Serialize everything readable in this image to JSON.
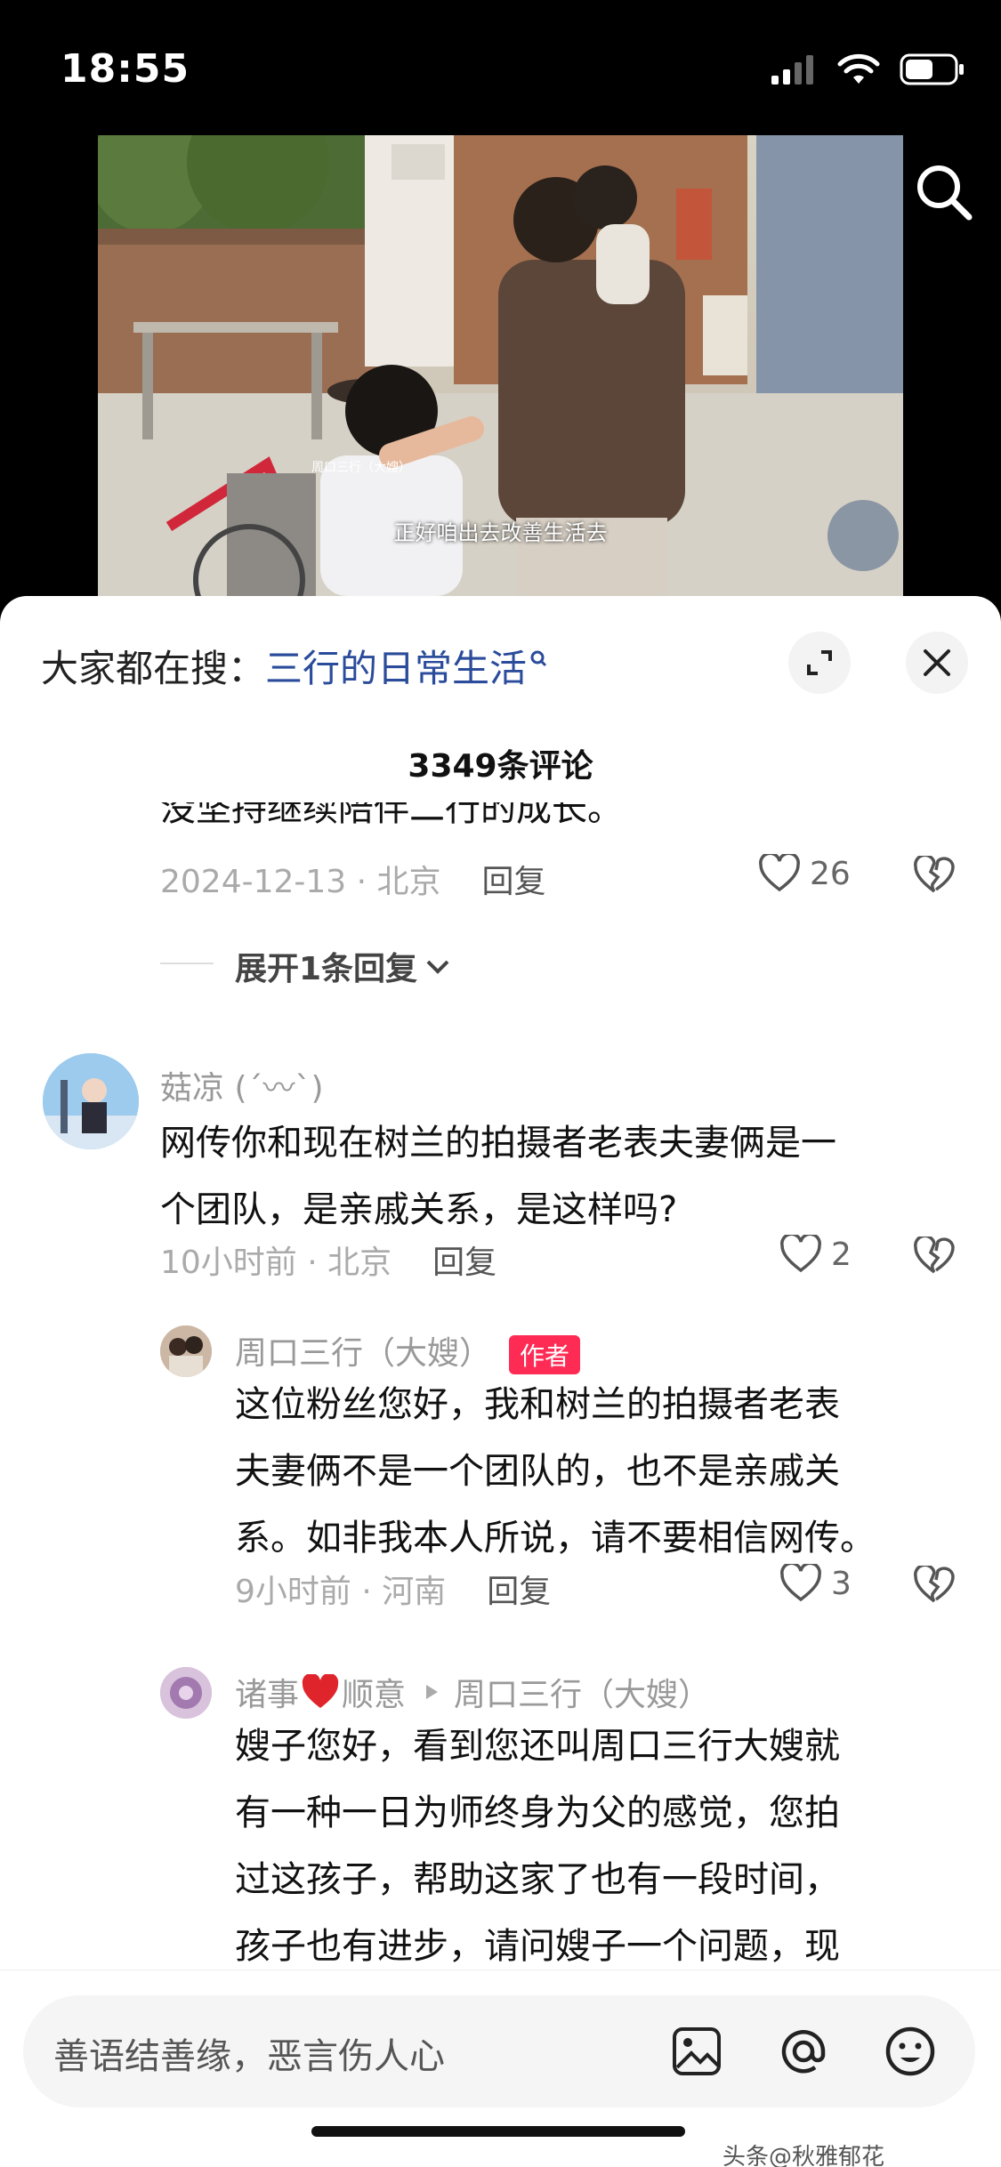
{
  "status_bar": {
    "time": "18:55"
  },
  "video": {
    "caption": "正好咱出去改善生活去"
  },
  "sheet": {
    "hot_search_prefix": "大家都在搜：",
    "hot_search_term": "三行的日常生活",
    "comment_count": "3349条评论"
  },
  "comments": [
    {
      "text_line": "没坚持继续陪伴二行的成长。",
      "time_location": "2024-12-13 · 北京",
      "reply_label": "回复",
      "likes": "26",
      "expand_replies": "展开1条回复"
    },
    {
      "username": "菇凉 (ˊ〰ˋ)",
      "text_lines": [
        "网传你和现在树兰的拍摄者老表夫妻俩是一",
        "个团队，是亲戚关系，是这样吗?"
      ],
      "time_location": "10小时前 · 北京",
      "reply_label": "回复",
      "likes": "2"
    },
    {
      "username": "周口三行（大嫂）",
      "badge": "作者",
      "text_lines": [
        "这位粉丝您好，我和树兰的拍摄者老表",
        "夫妻俩不是一个团队的，也不是亲戚关",
        "系。如非我本人所说，请不要相信网传。"
      ],
      "time_location": "9小时前 · 河南",
      "reply_label": "回复",
      "likes": "3"
    },
    {
      "username_part1": "诸事",
      "username_part2": "顺意",
      "reply_to": "周口三行（大嫂）",
      "text_lines": [
        "嫂子您好，看到您还叫周口三行大嫂就",
        "有一种一日为师终身为父的感觉，您拍",
        "过这孩子，帮助这家了也有一段时间，",
        "孩子也有进步，请问嫂子一个问题，现"
      ]
    }
  ],
  "input": {
    "placeholder": "善语结善缘，恶言伤人心"
  },
  "watermark": "头条@秋雅郁花"
}
